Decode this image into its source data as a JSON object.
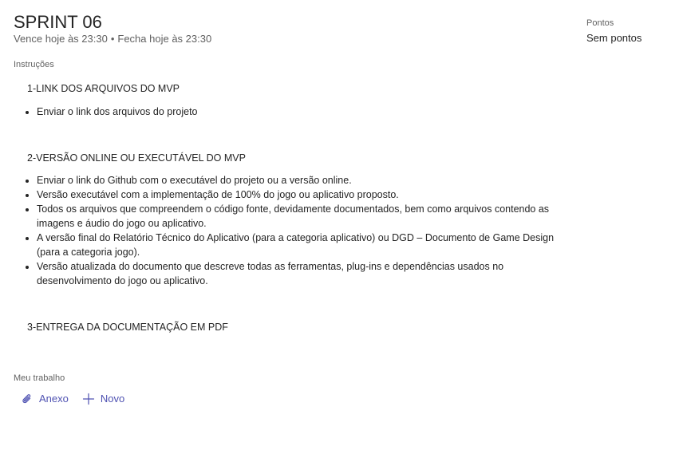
{
  "assignment": {
    "title": "SPRINT 06",
    "due": "Vence hoje às 23:30",
    "separator": "•",
    "closes": "Fecha hoje às 23:30"
  },
  "points": {
    "label": "Pontos",
    "value": "Sem pontos"
  },
  "instructions": {
    "label": "Instruções",
    "sections": [
      {
        "title": "1-LINK DOS ARQUIVOS DO MVP",
        "items": [
          "Enviar o link dos arquivos do projeto"
        ]
      },
      {
        "title": "2-VERSÃO ONLINE OU EXECUTÁVEL DO MVP",
        "items": [
          "Enviar o link do Github com o executável do projeto ou a versão online.",
          "Versão executável com a implementação de 100% do jogo ou aplicativo proposto.",
          "Todos os arquivos que compreendem o código fonte, devidamente documentados, bem como arquivos contendo as imagens e áudio do jogo ou aplicativo.",
          "A versão final do Relatório Técnico do Aplicativo (para a categoria aplicativo) ou DGD – Documento de Game Design (para a categoria jogo).",
          "Versão atualizada do documento que descreve todas as ferramentas, plug-ins e dependências usados no desenvolvimento do jogo ou aplicativo."
        ]
      },
      {
        "title": "3-ENTREGA DA DOCUMENTAÇÃO EM PDF",
        "items": []
      }
    ]
  },
  "my_work": {
    "label": "Meu trabalho",
    "attach_label": "Anexo",
    "new_label": "Novo",
    "attach_icon": "paperclip-icon",
    "new_icon": "plus-icon",
    "accent_color": "#4f52b2"
  }
}
